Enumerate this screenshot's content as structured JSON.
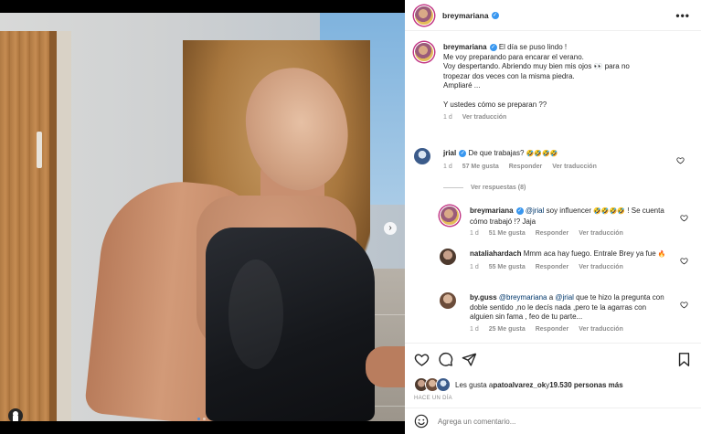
{
  "post": {
    "author": "breymariana",
    "more_label": "•••",
    "verified_mark": "✓"
  },
  "media": {
    "next_glyph": "›",
    "dots": 2
  },
  "caption": {
    "username": "breymariana",
    "lines": [
      "El día se puso lindo !",
      "Me voy preparando para encarar el verano.",
      "Voy despertando. Abriendo muy bien mis ojos 👀 para no",
      "tropezar dos veces con la misma piedra.",
      "Ampliaré ...",
      "",
      "Y ustedes cómo se preparan ??"
    ],
    "time": "1 d",
    "translate": "Ver traducción"
  },
  "comments": [
    {
      "username": "jrial",
      "text": "De que trabajas?",
      "emoji": "🤣🤣🤣🤣",
      "time": "1 d",
      "likes": "57 Me gusta",
      "reply": "Responder",
      "translate": "Ver traducción"
    }
  ],
  "view_replies": "Ver respuestas (8)",
  "replies": [
    {
      "username": "breymariana",
      "mention": "@jrial",
      "text_a": " soy influencer ",
      "emoji": "🤣🤣🤣🤣",
      "text_b": " ! Se cuenta cómo trabajó !? Jaja",
      "time": "1 d",
      "likes": "51 Me gusta",
      "reply": "Responder",
      "translate": "Ver traducción"
    },
    {
      "username": "nataliahardach",
      "text": "Mmm aca hay fuego. Entrale Brey ya fue",
      "emoji": "🔥",
      "time": "1 d",
      "likes": "55 Me gusta",
      "reply": "Responder",
      "translate": "Ver traducción"
    },
    {
      "username": "by.guss",
      "mention_a": "@breymariana",
      "mid": " a ",
      "mention_b": "@jrial",
      "text": " que te hizo la pregunta con doble sentido ,no le decís nada ,pero te la agarras con alguien sin fama , feo de tu parte...",
      "time": "1 d",
      "likes": "25 Me gusta",
      "reply": "Responder",
      "translate": "Ver traducción"
    }
  ],
  "likes": {
    "prefix": "Les gusta a ",
    "user": "patoalvarez_ok",
    "mid": " y ",
    "count": "19.530 personas más"
  },
  "time_ago": "HACE UN DÍA",
  "add_comment": {
    "placeholder": "Agrega un comentario..."
  }
}
